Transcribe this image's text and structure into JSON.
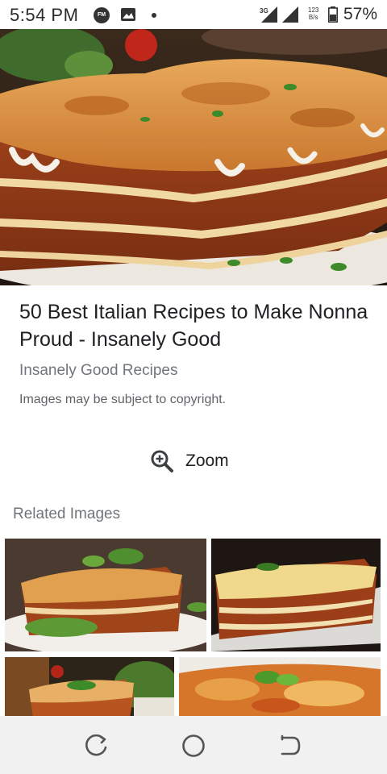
{
  "status_bar": {
    "time": "5:54 PM",
    "network": "3G",
    "speed_value": "123",
    "speed_unit": "B/s",
    "battery": "57%"
  },
  "result": {
    "title": "50 Best Italian Recipes to Make Nonna Proud - Insanely Good",
    "source": "Insanely Good Recipes",
    "copyright_note": "Images may be subject to copyright."
  },
  "zoom": {
    "label": "Zoom",
    "icon": "zoom-in-icon"
  },
  "related": {
    "label": "Related Images"
  },
  "nav": {
    "recent_icon": "recent-apps-icon",
    "home_icon": "home-icon",
    "back_icon": "back-icon"
  },
  "colors": {
    "text_primary": "#202124",
    "text_secondary": "#70757a",
    "nav_bg": "#f1f1f1"
  }
}
